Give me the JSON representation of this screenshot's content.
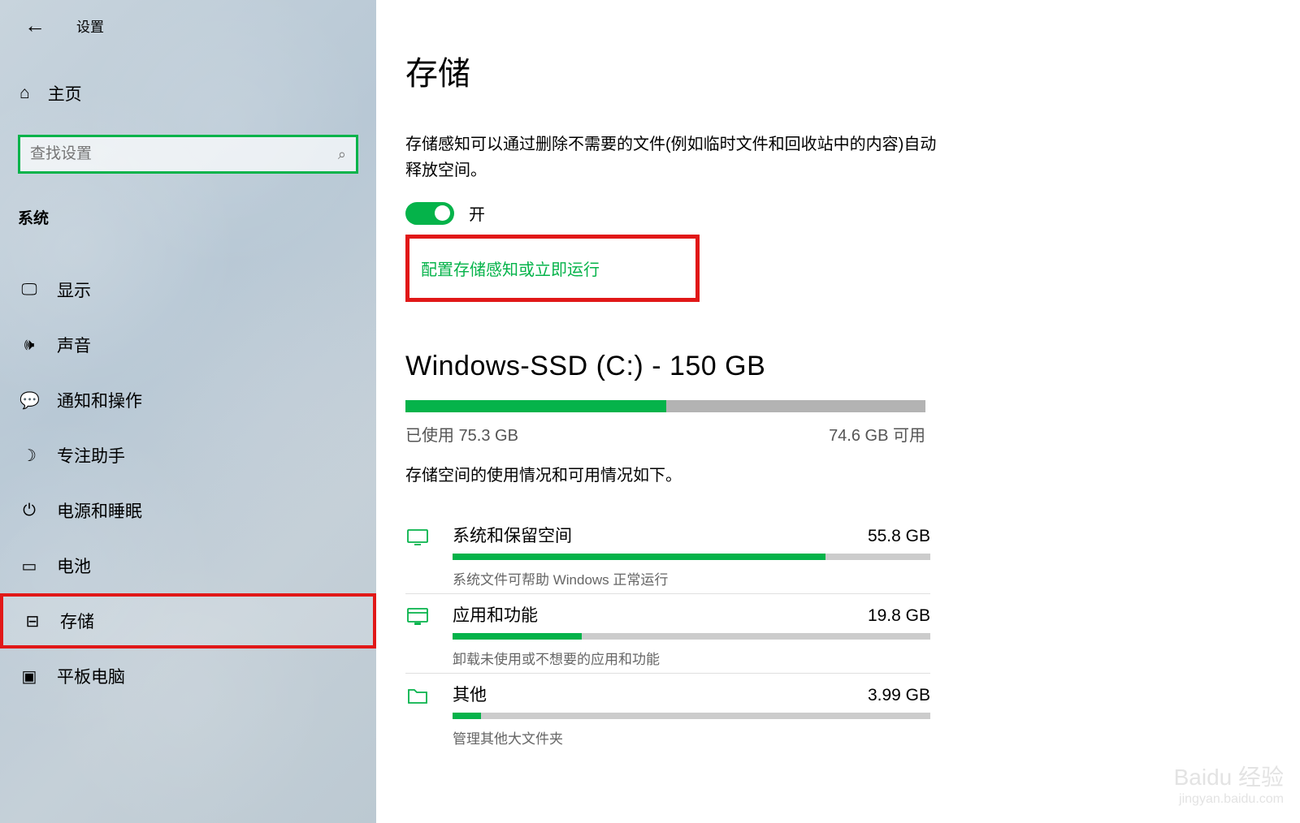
{
  "header": {
    "back_label": "设置"
  },
  "sidebar": {
    "home_label": "主页",
    "search_placeholder": "查找设置",
    "section_label": "系统",
    "items": [
      {
        "icon": "display",
        "label": "显示"
      },
      {
        "icon": "sound",
        "label": "声音"
      },
      {
        "icon": "notifications",
        "label": "通知和操作"
      },
      {
        "icon": "focus",
        "label": "专注助手"
      },
      {
        "icon": "power",
        "label": "电源和睡眠"
      },
      {
        "icon": "battery",
        "label": "电池"
      },
      {
        "icon": "storage",
        "label": "存储"
      },
      {
        "icon": "tablet",
        "label": "平板电脑"
      }
    ]
  },
  "main": {
    "title": "存储",
    "description": "存储感知可以通过删除不需要的文件(例如临时文件和回收站中的内容)自动释放空间。",
    "toggle": {
      "on": true,
      "label": "开"
    },
    "config_link": "配置存储感知或立即运行",
    "drive": {
      "title": "Windows-SSD (C:) - 150 GB",
      "used_pct": 50.2,
      "labels": {
        "used": "已使用 75.3 GB",
        "free": "74.6 GB 可用"
      }
    },
    "usage_desc": "存储空间的使用情况和可用情况如下。",
    "categories": [
      {
        "icon": "system",
        "name": "系统和保留空间",
        "size": "55.8 GB",
        "pct": 78,
        "sub": "系统文件可帮助 Windows 正常运行"
      },
      {
        "icon": "apps",
        "name": "应用和功能",
        "size": "19.8 GB",
        "pct": 27,
        "sub": "卸载未使用或不想要的应用和功能"
      },
      {
        "icon": "other",
        "name": "其他",
        "size": "3.99 GB",
        "pct": 6,
        "sub": "管理其他大文件夹"
      }
    ]
  },
  "watermark": {
    "brand": "Baidu 经验",
    "url": "jingyan.baidu.com"
  },
  "colors": {
    "accent": "#05b34a",
    "highlight_border": "#e11818"
  }
}
